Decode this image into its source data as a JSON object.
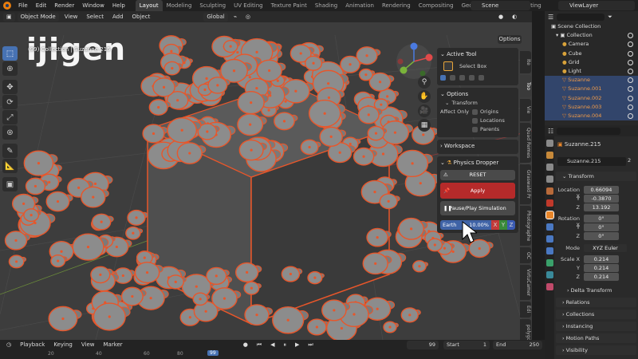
{
  "menu": [
    "File",
    "Edit",
    "Render",
    "Window",
    "Help"
  ],
  "workspaces": [
    "Layout",
    "Modeling",
    "Sculpting",
    "UV Editing",
    "Texture Paint",
    "Shading",
    "Animation",
    "Rendering",
    "Compositing",
    "Geometry Nodes",
    "Scripting"
  ],
  "scene_name": "Scene",
  "view_layer": "ViewLayer",
  "viewport": {
    "mode": "Object Mode",
    "menus": [
      "View",
      "Select",
      "Add",
      "Object"
    ],
    "orientation": "Global",
    "overlay_info": "(99) Collection | Suzanne.215",
    "options_label": "Options",
    "watermark": "ijigen",
    "side_tabs": [
      "Ite",
      "Too",
      "Vie",
      "Quad Remes",
      "Graswald Pr",
      "Photographe",
      "OC",
      "VirtuCamer",
      "Edi",
      "polygoni"
    ]
  },
  "npanel": {
    "active_tool": {
      "title": "Active Tool",
      "tool_name": "Select Box"
    },
    "options": {
      "title": "Options",
      "transform_label": "Transform",
      "affect_only_label": "Affect Only",
      "checkboxes": [
        "Origins",
        "Locations",
        "Parents"
      ]
    },
    "workspace_label": "Workspace",
    "physics": {
      "title": "Physics Dropper",
      "reset_label": "RESET",
      "apply_label": "Apply",
      "pause_label": "Pause/Play Simulation",
      "gravity_preset": "Earth",
      "gravity_value": "10.00%",
      "axes": [
        "X",
        "Y",
        "Z"
      ]
    }
  },
  "outliner": {
    "header": "Scene Collection",
    "collection": "Collection",
    "items": [
      "Camera",
      "Cube",
      "Grid",
      "Light",
      "Suzanne",
      "Suzanne.001",
      "Suzanne.002",
      "Suzanne.003",
      "Suzanne.004"
    ]
  },
  "properties": {
    "object_name": "Suzanne.215",
    "datablock_name": "Suzanne.215",
    "users": "2",
    "transform_title": "Transform",
    "location_label": "Location X",
    "location": [
      "0.66094",
      "-0.3870",
      "13.192"
    ],
    "rotation_label": "Rotation X",
    "rotation": [
      "0°",
      "0°",
      "0°"
    ],
    "mode_label": "Mode",
    "mode_value": "XYZ Euler",
    "scale_label": "Scale X",
    "scale": [
      "0.214",
      "0.214",
      "0.214"
    ],
    "axis_y": "Y",
    "axis_z": "Z",
    "delta_label": "Delta Transform",
    "sections": [
      "Relations",
      "Collections",
      "Instancing",
      "Motion Paths",
      "Visibility"
    ]
  },
  "timeline": {
    "menus": [
      "Playback",
      "Keying",
      "View",
      "Marker"
    ],
    "current_frame": "99",
    "start_label": "Start",
    "start": "1",
    "end_label": "End",
    "end": "250",
    "ruler": [
      "20",
      "40",
      "60",
      "80",
      "99"
    ]
  },
  "colors": {
    "accent": "#4772b3",
    "selection_outline": "#e8562a",
    "apply": "#b52a2a",
    "gravity_field": "#3f63a6"
  }
}
